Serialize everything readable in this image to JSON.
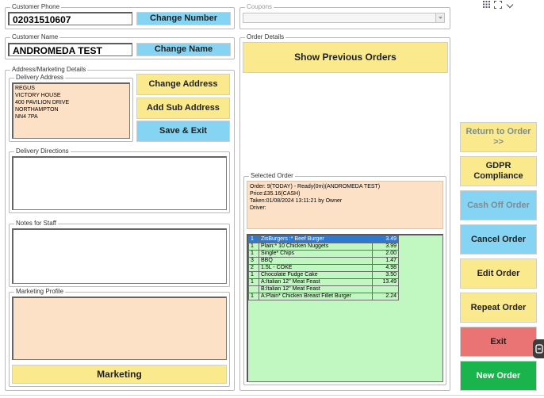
{
  "customer_phone": {
    "label": "Customer Phone",
    "value": "02031510607",
    "button": "Change Number"
  },
  "coupons": {
    "label": "Coupons",
    "selected": ""
  },
  "customer_name": {
    "label": "Customer Name",
    "value": "ANDROMEDA TEST",
    "button": "Change Name"
  },
  "address_section": {
    "label": "Address/Marketing Details",
    "delivery_address_label": "Delivery Address",
    "address_lines": [
      "REGUS",
      "VICTORY HOUSE",
      "400 PAVILION DRIVE",
      "NORTHAMPTON",
      "NN4 7PA"
    ],
    "change_address": "Change Address",
    "add_sub_address": "Add Sub Address",
    "save_exit": "Save & Exit"
  },
  "delivery_directions": {
    "label": "Delivery Directions",
    "value": ""
  },
  "notes_for_staff": {
    "label": "Notes for Staff",
    "value": ""
  },
  "marketing_profile": {
    "label": "Marketing Profile",
    "button": "Marketing"
  },
  "order_details": {
    "label": "Order Details",
    "show_previous": "Show Previous Orders"
  },
  "selected_order": {
    "label": "Selected Order",
    "info_lines": [
      "Order: 9(TODAY) - Ready(0m)(ANDROMEDA TEST)",
      "Price:£35.16(CASH)",
      "Taken:01/08/2024 13:11:21 by Owner",
      "Driver:"
    ],
    "items": [
      {
        "qty": "1",
        "desc": "ZisBurgers :* Beef Burger",
        "price": "3.49",
        "selected": true
      },
      {
        "qty": "1",
        "desc": "Plain:* 10 Chicken Nuggets",
        "price": "3.99",
        "selected": false
      },
      {
        "qty": "1",
        "desc": "Single* Chips",
        "price": "2.00",
        "selected": false
      },
      {
        "qty": "3",
        "desc": "BBQ",
        "price": "1.47",
        "selected": false
      },
      {
        "qty": "2",
        "desc": "1.5L - COKE",
        "price": "4.98",
        "selected": false
      },
      {
        "qty": "1",
        "desc": "Chocolate Fudge Cake",
        "price": "3.50",
        "selected": false
      },
      {
        "qty": "1",
        "desc": "A:Italian 12'' Meat Feast",
        "price": "13.49",
        "selected": false
      },
      {
        "qty": "",
        "desc": "B:Italian 12'' Meat Feast",
        "price": "",
        "selected": false
      },
      {
        "qty": "1",
        "desc": "A:Plain* Chicken Breast Fillet Burger",
        "price": "2.24",
        "selected": false
      }
    ]
  },
  "actions": {
    "return_to_order_l1": "Return to Order",
    "return_to_order_l2": ">>",
    "gdpr_l1": "GDPR",
    "gdpr_l2": "Compliance",
    "cash_off": "Cash Off Order",
    "cancel": "Cancel Order",
    "edit": "Edit Order",
    "repeat": "Repeat Order",
    "exit": "Exit",
    "new_order": "New Order"
  },
  "window_controls": [
    "grid-icon",
    "expand-icon",
    "chevron-down-icon"
  ],
  "colors": {
    "yellow": "#fbe98e",
    "blue": "#85d4f4",
    "peach": "#fde1c6",
    "green_list": "#c1f7c1",
    "red": "#ea7474",
    "green": "#1ab44c",
    "selection": "#2c78d3"
  }
}
